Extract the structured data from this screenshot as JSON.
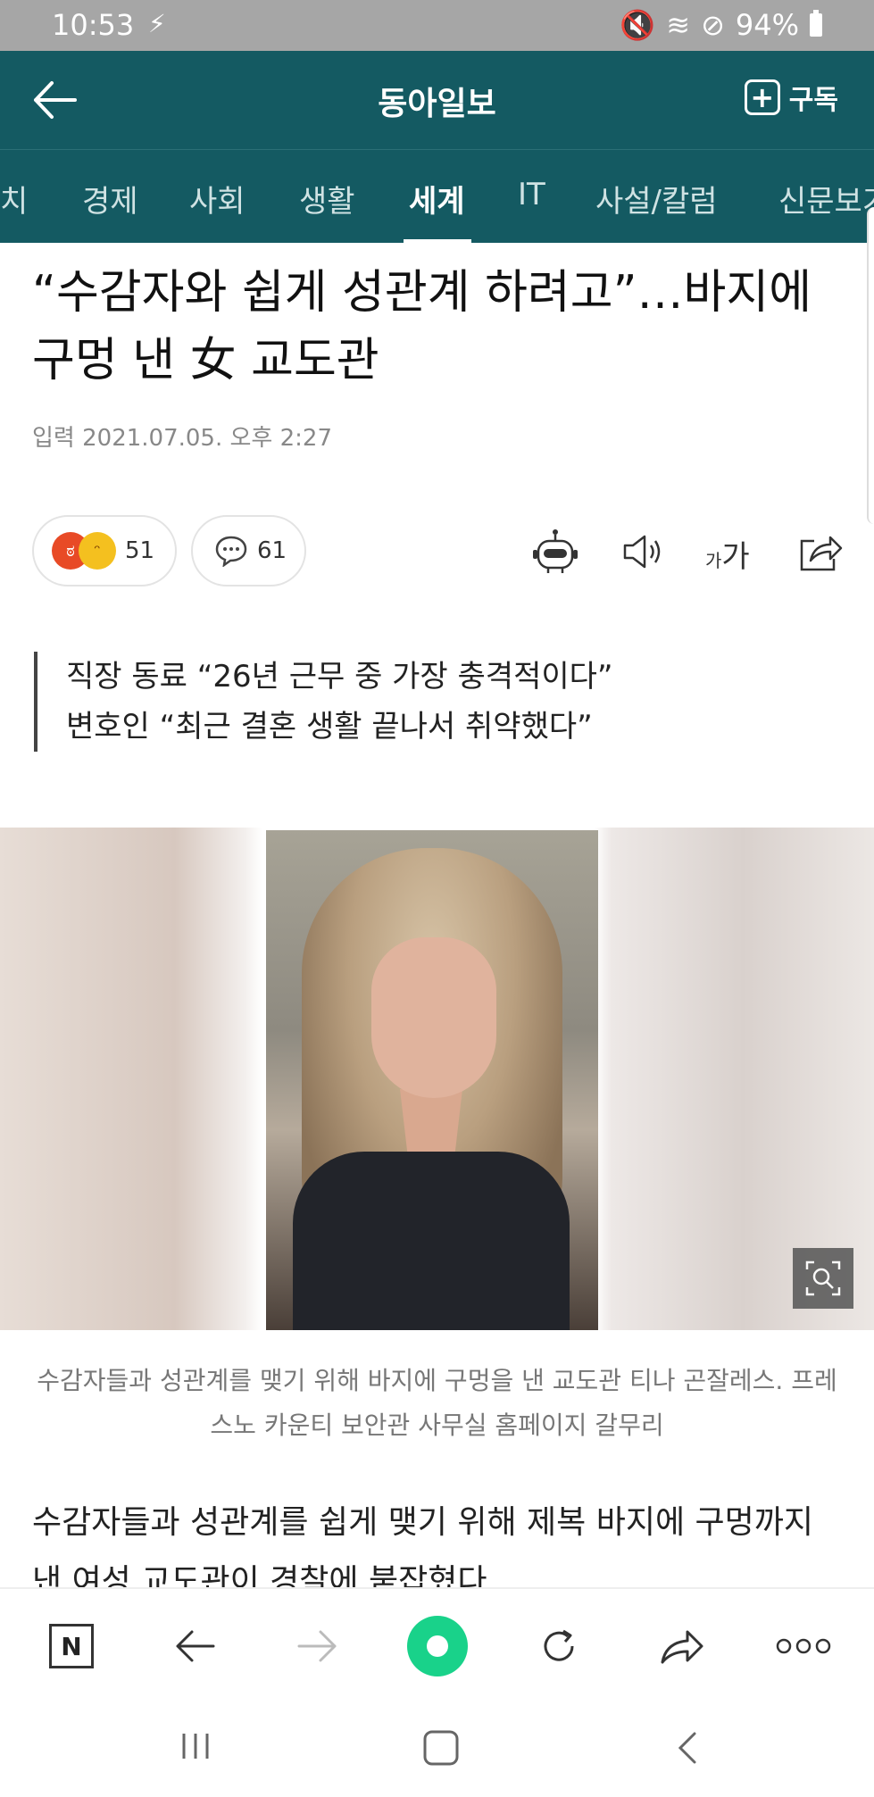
{
  "status_bar": {
    "time": "10:53",
    "battery": "94%"
  },
  "app_bar": {
    "title": "동아일보",
    "subscribe_label": "구독"
  },
  "tabs": [
    {
      "label": "치"
    },
    {
      "label": "경제"
    },
    {
      "label": "사회"
    },
    {
      "label": "생활"
    },
    {
      "label": "세계"
    },
    {
      "label": "IT"
    },
    {
      "label": "사설/칼럼"
    },
    {
      "label": "신문보기"
    }
  ],
  "article": {
    "headline": "“수감자와 쉽게 성관계 하려고”…바지에 구멍 낸 女 교도관",
    "date": "입력 2021.07.05. 오후 2:27",
    "reaction_count": "51",
    "comment_count": "61",
    "font_label_small": "가",
    "font_label_big": "가",
    "subtitle_lines": [
      "직장 동료 “26년 근무 중 가장 충격적이다”",
      "변호인 “최근 결혼 생활 끝나서 취약했다”"
    ],
    "caption": "수감자들과 성관계를 맺기 위해 바지에 구멍을 낸 교도관 티나 곤잘레스. 프레스노 카운티 보안관 사무실 홈페이지 갈무리",
    "body": "수감자들과 성관계를 쉽게 맺기 위해 제복 바지에 구멍까지 낸 여성 교도관이 경찰에 붙잡혔다"
  },
  "colors": {
    "brand": "#145a62",
    "home_button": "#19d28a"
  }
}
